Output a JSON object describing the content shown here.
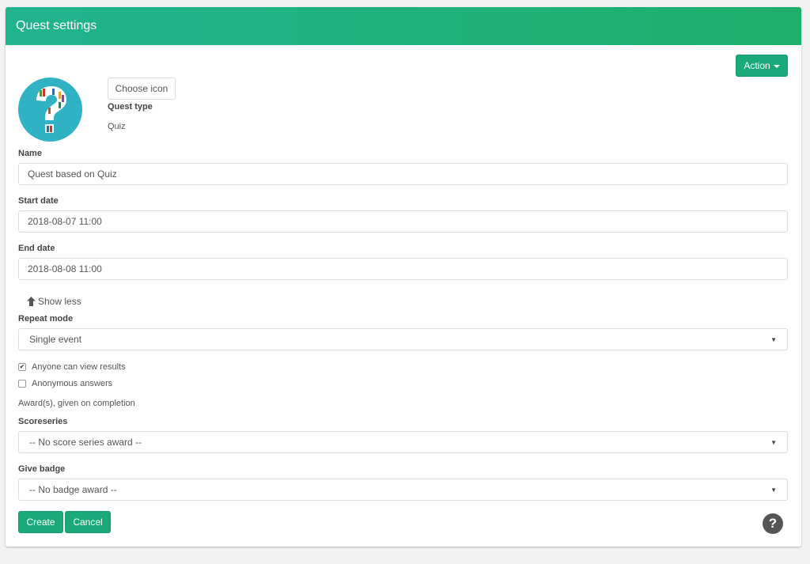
{
  "header": {
    "title": "Quest settings"
  },
  "toolbar": {
    "action_label": "Action"
  },
  "icon_section": {
    "choose_icon_label": "Choose icon",
    "quest_type_label": "Quest type",
    "quest_type_value": "Quiz",
    "icon": "question-mark-books-icon"
  },
  "form": {
    "name": {
      "label": "Name",
      "value": "Quest based on Quiz"
    },
    "start_date": {
      "label": "Start date",
      "value": "2018-08-07 11:00"
    },
    "end_date": {
      "label": "End date",
      "value": "2018-08-08 11:00"
    },
    "show_less_label": "Show less",
    "repeat_mode": {
      "label": "Repeat mode",
      "value": "Single event"
    },
    "anyone_can_view": {
      "label": "Anyone can view results",
      "checked": true
    },
    "anonymous_answers": {
      "label": "Anonymous answers",
      "checked": false
    },
    "awards_text": "Award(s), given on completion",
    "scoreseries": {
      "label": "Scoreseries",
      "value": "-- No score series award --"
    },
    "give_badge": {
      "label": "Give badge",
      "value": "-- No badge award --"
    }
  },
  "footer": {
    "create_label": "Create",
    "cancel_label": "Cancel",
    "help_glyph": "?"
  },
  "colors": {
    "header_start": "#20b38f",
    "header_end": "#1eb06a",
    "button_green": "#1aa97a",
    "icon_circle": "#2fb3c4"
  }
}
